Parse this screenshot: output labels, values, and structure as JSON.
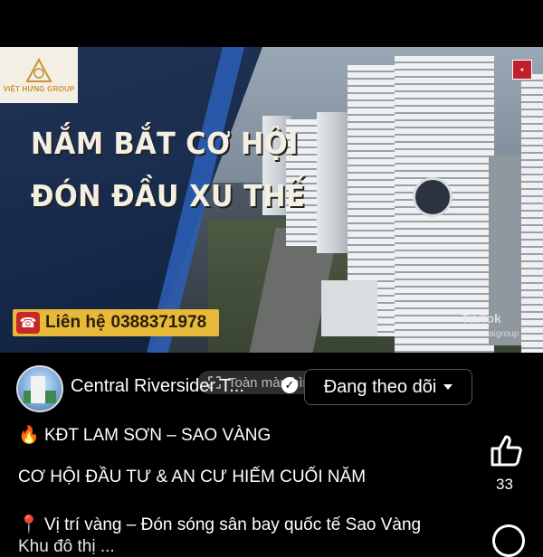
{
  "video": {
    "logo_text": "VIỆT HƯNG GROUP",
    "logo_subtext": "",
    "headline_line1": "NẮM BẮT CƠ HỘI",
    "headline_line2": "ĐÓN ĐẦU XU THẾ",
    "contact_label": "Liên hệ",
    "contact_phone": "0388371978",
    "watermark_brand": "TikTok",
    "watermark_user": "aigroup",
    "accent_color": "#e6b93a",
    "panel_color": "#1c2e52"
  },
  "overlay": {
    "fullscreen_label": "Toàn màn hình"
  },
  "channel": {
    "name": "Central Riversider T...",
    "follow_label": "Đang theo dõi"
  },
  "post": {
    "line1_emoji": "🔥",
    "line1": "KĐT LAM SƠN – SAO VÀNG",
    "line2": "CƠ HỘI ĐẦU TƯ & AN CƯ HIẾM CUỐI NĂM",
    "line3_emoji": "📍",
    "line3": "Vị trí vàng – Đón sóng sân bay quốc tế Sao Vàng",
    "line4": "Khu đô thị ... "
  },
  "reactions": {
    "like_icon": "thumbs-up-icon",
    "like_count": "33",
    "comment_icon": "comment-icon"
  }
}
